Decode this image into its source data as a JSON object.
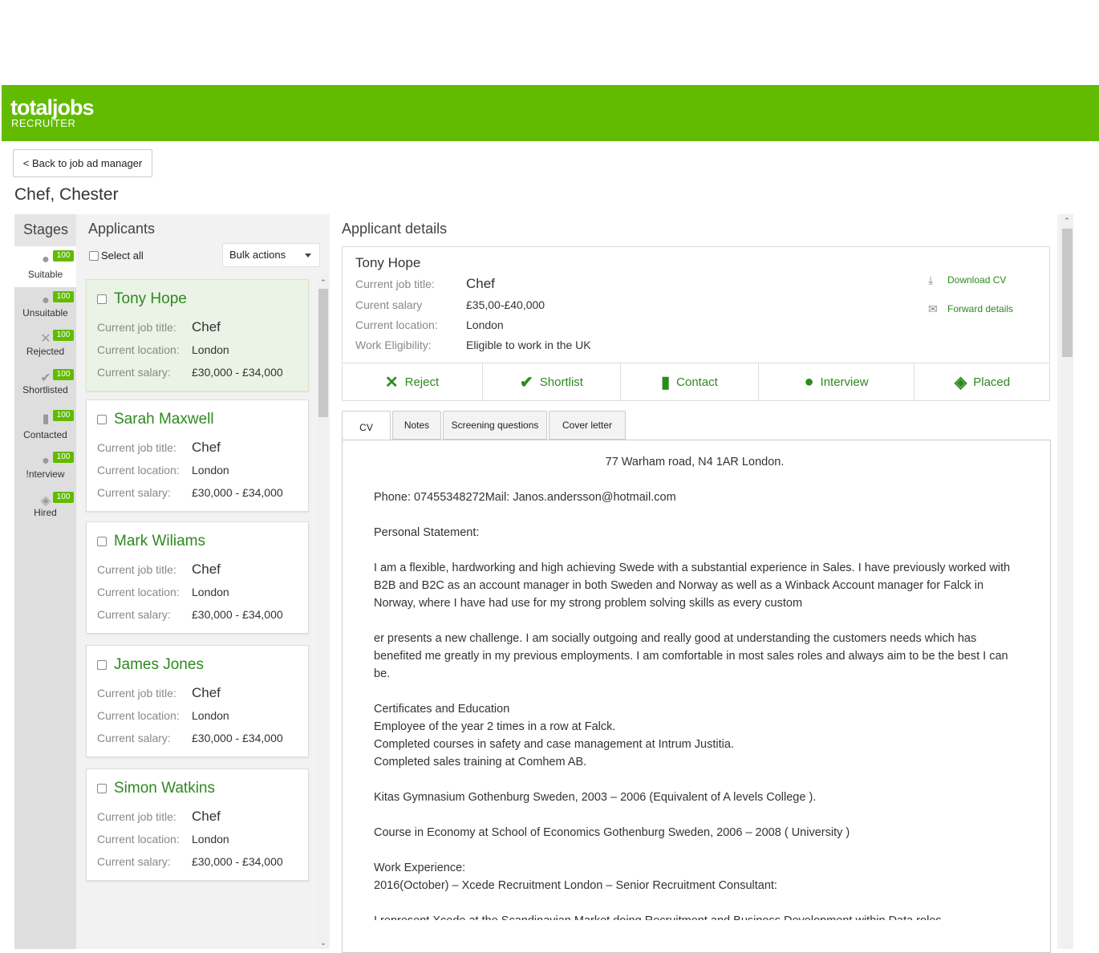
{
  "header": {
    "logo_main": "totaljobs",
    "logo_sub": "RECRUITER",
    "brand_color": "#62bb00"
  },
  "nav": {
    "back_label": "< Back to job ad manager"
  },
  "page": {
    "title": "Chef, Chester"
  },
  "stages": {
    "heading": "Stages",
    "items": [
      {
        "label": "Suitable",
        "count": "100",
        "icon": "person-icon"
      },
      {
        "label": "Unsuitable",
        "count": "100",
        "icon": "person-x-icon"
      },
      {
        "label": "Rejected",
        "count": "100",
        "icon": "x-icon"
      },
      {
        "label": "Shortlisted",
        "count": "100",
        "icon": "check-icon"
      },
      {
        "label": "Contacted",
        "count": "100",
        "icon": "contact-card-icon"
      },
      {
        "label": "!nterview",
        "count": "100",
        "icon": "interview-person-icon"
      },
      {
        "label": "Hired",
        "count": "100",
        "icon": "handshake-icon"
      }
    ]
  },
  "applicants": {
    "heading": "Applicants",
    "select_all": "Select all",
    "bulk_actions": "Bulk actions",
    "labels": {
      "job_title": "Current job title:",
      "location": "Current location:",
      "salary": "Current salary:"
    },
    "items": [
      {
        "name": "Tony Hope",
        "job_title": "Chef",
        "location": "London",
        "salary": "£30,000 - £34,000"
      },
      {
        "name": "Sarah Maxwell",
        "job_title": "Chef",
        "location": "London",
        "salary": "£30,000 - £34,000"
      },
      {
        "name": "Mark Wiliams",
        "job_title": "Chef",
        "location": "London",
        "salary": "£30,000 - £34,000"
      },
      {
        "name": "James Jones",
        "job_title": "Chef",
        "location": "London",
        "salary": "£30,000 - £34,000"
      },
      {
        "name": "Simon Watkins",
        "job_title": "Chef",
        "location": "London",
        "salary": "£30,000 - £34,000"
      }
    ]
  },
  "details": {
    "heading": "Applicant details",
    "name": "Tony Hope",
    "rows": [
      {
        "label": "Current job title:",
        "value": "Chef"
      },
      {
        "label": "Curent salary",
        "value": "£35,00-£40,000"
      },
      {
        "label": "Current location:",
        "value": "London"
      },
      {
        "label": "Work Eligibility:",
        "value": "Eligible to work in the UK"
      }
    ],
    "download_cv": "Download CV",
    "forward_details": "Forward details",
    "actions": {
      "reject": "Reject",
      "shortlist": "Shortlist",
      "contact": "Contact",
      "interview": "Interview",
      "placed": "Placed"
    },
    "tabs": {
      "cv": "CV",
      "notes": "Notes",
      "screening": "Screening questions",
      "cover": "Cover letter"
    }
  },
  "cv": {
    "address": "77 Warham road, N4 1AR London.",
    "contact": "Phone: 07455348272Mail: Janos.andersson@hotmail.com",
    "ps_heading": "Personal Statement:",
    "ps1": "I am a flexible, hardworking and high achieving Swede with a substantial experience in Sales. I have previously worked with B2B and B2C as an account manager in both Sweden and Norway as well as a Winback Account manager for Falck in Norway, where I have had use for my strong problem solving skills as every custom",
    "ps2": "er presents a new challenge. I am socially outgoing and really good at understanding the customers needs which has benefited me greatly in my previous employments. I am comfortable in most sales roles and always aim to be the best I can be.",
    "cert_heading": "Certificates and Education",
    "cert1": "Employee of the year 2 times in a row at Falck.",
    "cert2": "Completed courses in safety and case management at Intrum Justitia.",
    "cert3": "Completed sales training at Comhem AB.",
    "edu1": "Kitas Gymnasium Gothenburg Sweden, 2003 – 2006 (Equivalent of A levels College ).",
    "edu2": "Course in Economy at School of Economics Gothenburg Sweden, 2006 – 2008 ( University )",
    "work_heading": "Work Experience:",
    "work1": "2016(October) – Xcede Recruitment London – Senior Recruitment Consultant:",
    "work2": "I represent Xcede at the Scandinavian Market doing Recruitment and Business Development within Data roles"
  }
}
